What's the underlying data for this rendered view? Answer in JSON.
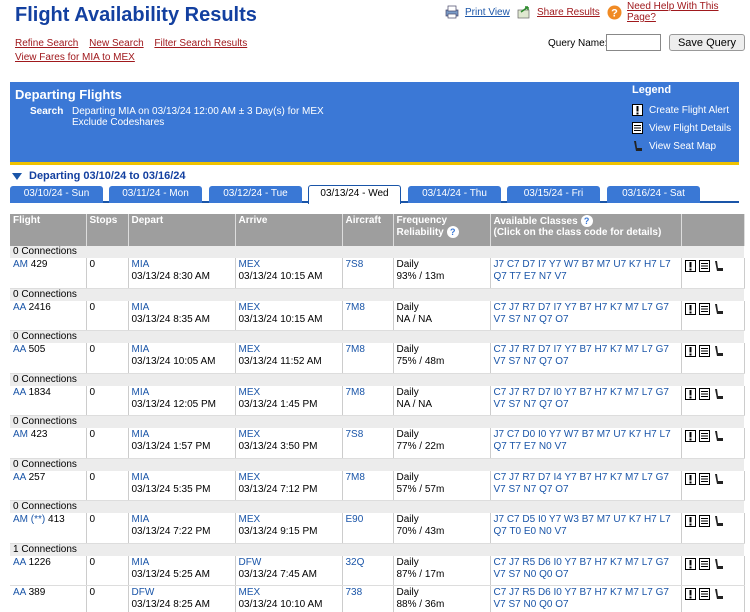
{
  "header": {
    "title": "Flight Availability Results",
    "print_view": "Print View",
    "share_results": "Share Results",
    "need_help": "Need Help With This Page?",
    "refine_search": "Refine Search",
    "new_search": "New Search",
    "filter_search": "Filter Search Results",
    "view_fares": "View Fares for MIA to MEX",
    "query_name_label": "Query Name:",
    "query_name_value": "",
    "save_query": "Save Query"
  },
  "departing": {
    "panel_title": "Departing Flights",
    "search_label": "Search",
    "search_line1": "Departing MIA on 03/13/24 12:00 AM ± 3 Day(s) for MEX",
    "search_line2": "Exclude Codeshares",
    "legend_title": "Legend",
    "legend_items": [
      "Create Flight Alert",
      "View Flight Details",
      "View Seat Map"
    ],
    "range_label": "Departing 03/10/24 to 03/16/24"
  },
  "tabs": [
    "03/10/24 - Sun",
    "03/11/24 - Mon",
    "03/12/24 - Tue",
    "03/13/24 - Wed",
    "03/14/24 - Thu",
    "03/15/24 - Fri",
    "03/16/24 - Sat"
  ],
  "active_tab": "03/13/24 - Wed",
  "table": {
    "headers": {
      "flight": "Flight",
      "stops": "Stops",
      "depart": "Depart",
      "arrive": "Arrive",
      "aircraft": "Aircraft",
      "frequency": "Frequency",
      "reliability": "Reliability",
      "classes_title": "Available Classes",
      "classes_sub": "(Click on the class code for details)"
    },
    "groups": [
      {
        "connections": "0 Connections",
        "flights": [
          {
            "airline": "AM",
            "number": "429",
            "stops": "0",
            "dep_code": "MIA",
            "dep_time": "03/13/24 8:30 AM",
            "arr_code": "MEX",
            "arr_time": "03/13/24 10:15 AM",
            "aircraft": "7S8",
            "frequency": "Daily",
            "reliability": "93% / 13m",
            "classes1": "J7 C7 D7 I7 Y7 W7 B7 M7 U7 K7 H7 L7",
            "classes2": "Q7 T7 E7 N7 V7"
          }
        ]
      },
      {
        "connections": "0 Connections",
        "flights": [
          {
            "airline": "AA",
            "number": "2416",
            "stops": "0",
            "dep_code": "MIA",
            "dep_time": "03/13/24 8:35 AM",
            "arr_code": "MEX",
            "arr_time": "03/13/24 10:15 AM",
            "aircraft": "7M8",
            "frequency": "Daily",
            "reliability": "NA / NA",
            "classes1": "C7 J7 R7 D7 I7 Y7 B7 H7 K7 M7 L7 G7",
            "classes2": "V7 S7 N7 Q7 O7"
          }
        ]
      },
      {
        "connections": "0 Connections",
        "flights": [
          {
            "airline": "AA",
            "number": "505",
            "stops": "0",
            "dep_code": "MIA",
            "dep_time": "03/13/24 10:05 AM",
            "arr_code": "MEX",
            "arr_time": "03/13/24 11:52 AM",
            "aircraft": "7M8",
            "frequency": "Daily",
            "reliability": "75% / 48m",
            "classes1": "C7 J7 R7 D7 I7 Y7 B7 H7 K7 M7 L7 G7",
            "classes2": "V7 S7 N7 Q7 O7"
          }
        ]
      },
      {
        "connections": "0 Connections",
        "flights": [
          {
            "airline": "AA",
            "number": "1834",
            "stops": "0",
            "dep_code": "MIA",
            "dep_time": "03/13/24 12:05 PM",
            "arr_code": "MEX",
            "arr_time": "03/13/24 1:45 PM",
            "aircraft": "7M8",
            "frequency": "Daily",
            "reliability": "NA / NA",
            "classes1": "C7 J7 R7 D7 I0 Y7 B7 H7 K7 M7 L7 G7",
            "classes2": "V7 S7 N7 Q7 O7"
          }
        ]
      },
      {
        "connections": "0 Connections",
        "flights": [
          {
            "airline": "AM",
            "number": "423",
            "stops": "0",
            "dep_code": "MIA",
            "dep_time": "03/13/24 1:57 PM",
            "arr_code": "MEX",
            "arr_time": "03/13/24 3:50 PM",
            "aircraft": "7S8",
            "frequency": "Daily",
            "reliability": "77% / 22m",
            "classes1": "J7 C7 D0 I0 Y7 W7 B7 M7 U7 K7 H7 L7",
            "classes2": "Q7 T7 E7 N0 V7"
          }
        ]
      },
      {
        "connections": "0 Connections",
        "flights": [
          {
            "airline": "AA",
            "number": "257",
            "stops": "0",
            "dep_code": "MIA",
            "dep_time": "03/13/24 5:35 PM",
            "arr_code": "MEX",
            "arr_time": "03/13/24 7:12 PM",
            "aircraft": "7M8",
            "frequency": "Daily",
            "reliability": "57% / 57m",
            "classes1": "C7 J7 R7 D7 I4 Y7 B7 H7 K7 M7 L7 G7",
            "classes2": "V7 S7 N7 Q7 O7"
          }
        ]
      },
      {
        "connections": "0 Connections",
        "flights": [
          {
            "airline": "AM (**)",
            "number": "413",
            "stops": "0",
            "dep_code": "MIA",
            "dep_time": "03/13/24 7:22 PM",
            "arr_code": "MEX",
            "arr_time": "03/13/24 9:15 PM",
            "aircraft": "E90",
            "frequency": "Daily",
            "reliability": "70% / 43m",
            "classes1": "J7 C7 D5 I0 Y7 W3 B7 M7 U7 K7 H7 L7",
            "classes2": "Q7 T0 E0 N0 V7"
          }
        ]
      },
      {
        "connections": "1 Connections",
        "flights": [
          {
            "airline": "AA",
            "number": "1226",
            "stops": "0",
            "dep_code": "MIA",
            "dep_time": "03/13/24 5:25 AM",
            "arr_code": "DFW",
            "arr_time": "03/13/24 7:45 AM",
            "aircraft": "32Q",
            "frequency": "Daily",
            "reliability": "87% / 17m",
            "classes1": "C7 J7 R5 D6 I0 Y7 B7 H7 K7 M7 L7 G7",
            "classes2": "V7 S7 N0 Q0 O7"
          },
          {
            "airline": "AA",
            "number": "389",
            "stops": "0",
            "dep_code": "DFW",
            "dep_time": "03/13/24 8:25 AM",
            "arr_code": "MEX",
            "arr_time": "03/13/24 10:10 AM",
            "aircraft": "738",
            "frequency": "Daily",
            "reliability": "88% / 36m",
            "classes1": "C7 J7 R5 D6 I0 Y7 B7 H7 K7 M7 L7 G7",
            "classes2": "V7 S7 N0 Q0 O7"
          }
        ]
      }
    ]
  },
  "colors": {
    "accent": "#1340a0",
    "panel": "#3b78d6",
    "link_red": "#a0191d",
    "header_gray": "#9e9e9e"
  },
  "icons": [
    "print-icon",
    "share-icon",
    "help-icon",
    "alert-icon",
    "details-icon",
    "seat-map-icon"
  ]
}
